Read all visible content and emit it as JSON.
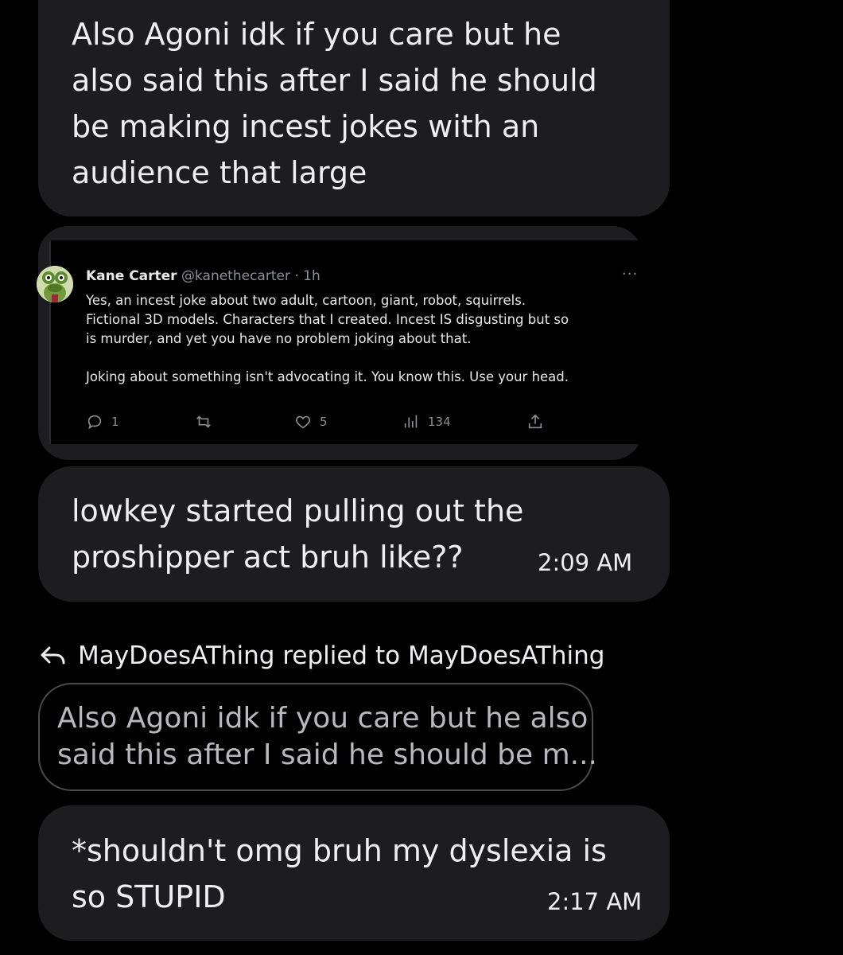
{
  "messages": [
    {
      "text": "Also Agoni idk if you care but he\nalso said this after I said he should\nbe making incest jokes with an\naudience that large",
      "time": ""
    },
    {
      "text": "lowkey started pulling out the\nproshipper act bruh like??",
      "time": "2:09 AM"
    },
    {
      "text": "*shouldn't omg bruh my dyslexia is\nso STUPID",
      "time": "2:17 AM"
    }
  ],
  "tweet": {
    "name": "Kane Carter",
    "handle": "@kanethecarter · 1h",
    "body": "Yes, an incest joke about two adult, cartoon, giant, robot, squirrels.\nFictional 3D models. Characters that I created. Incest IS disgusting but so\nis murder, and yet you have no problem joking about that.\n\nJoking about something isn't advocating it. You know this. Use your head.",
    "more_icon": "more-horizontal-icon",
    "replies": "1",
    "likes": "5",
    "views": "134"
  },
  "reply": {
    "header": "MayDoesAThing replied to MayDoesAThing",
    "quote": "Also Agoni idk if you care but he also\nsaid this after I said he should be m..."
  },
  "colors": {
    "background": "#000000",
    "bubble": "#1d1d20",
    "text": "#efeff2",
    "muted": "#8b9096"
  }
}
